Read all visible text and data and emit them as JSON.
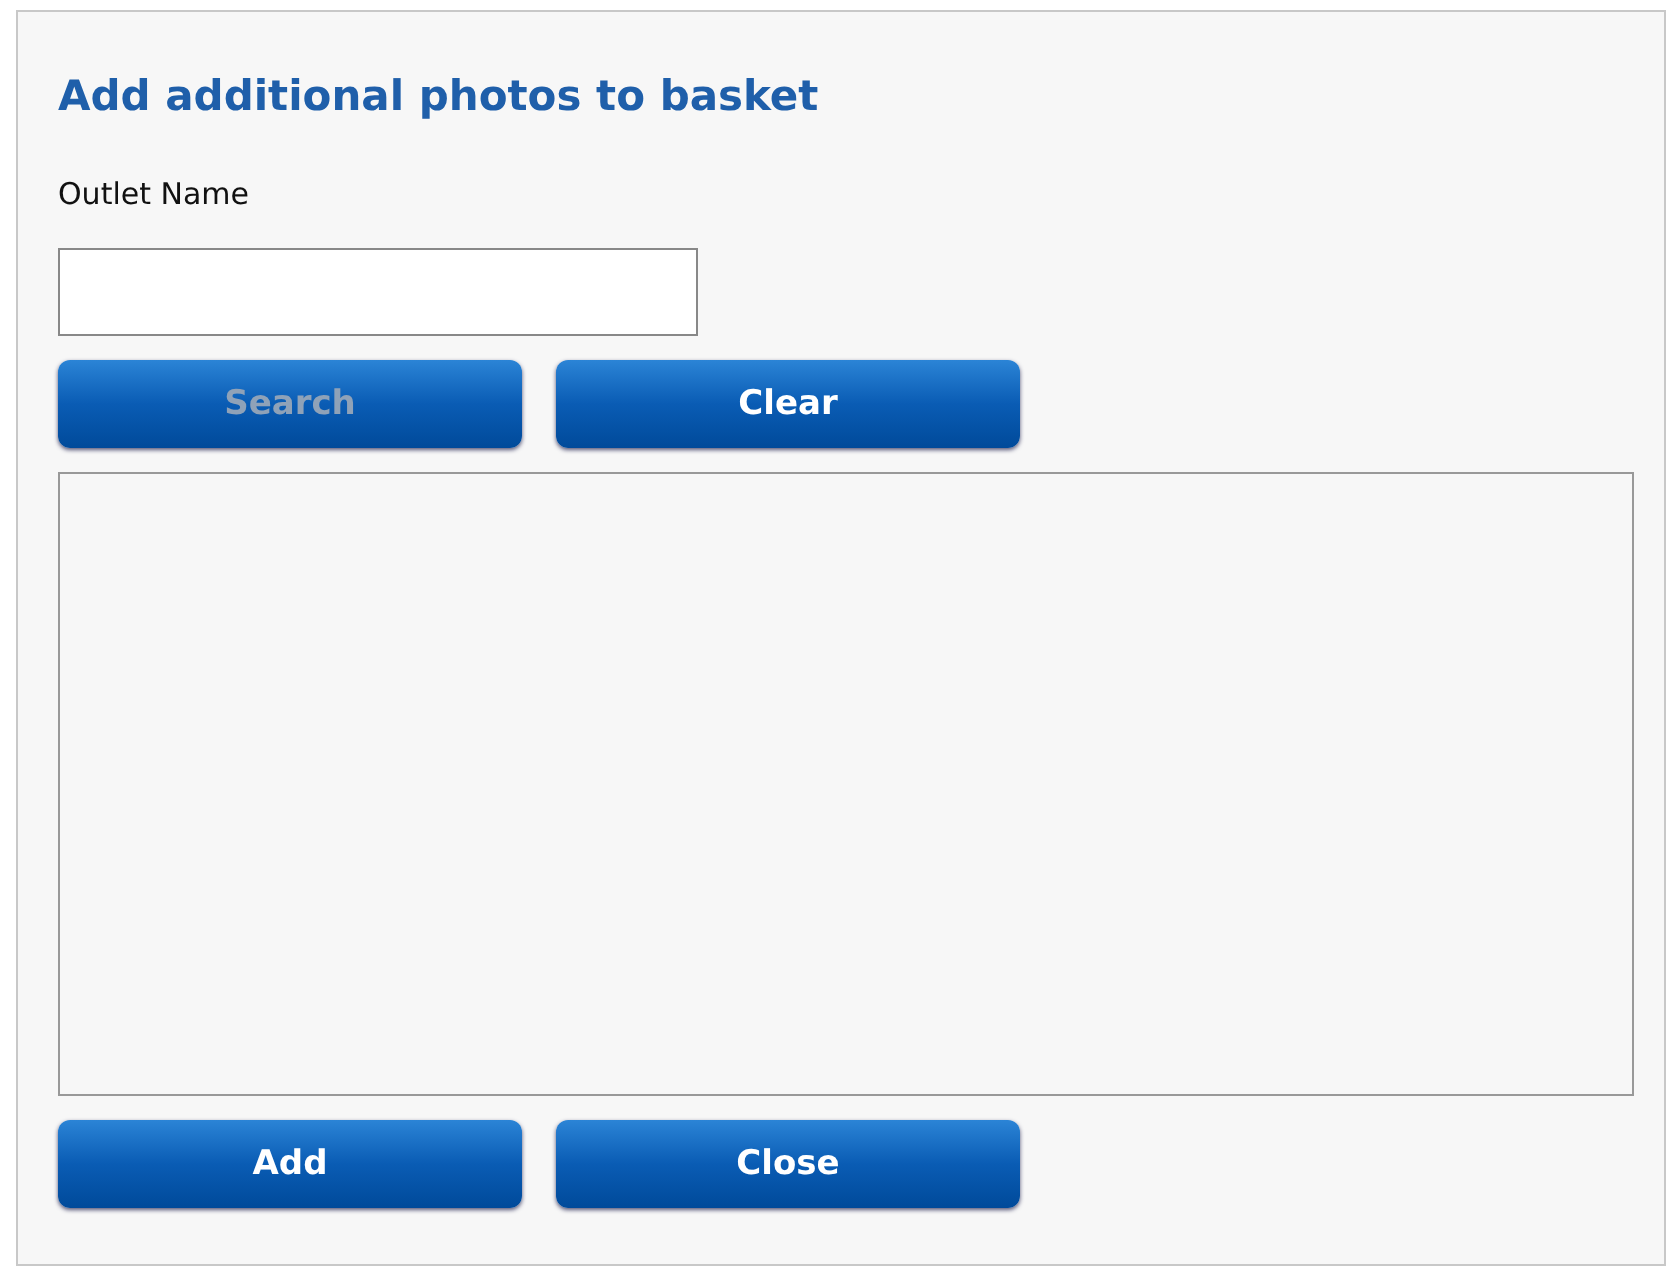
{
  "dialog": {
    "title": "Add additional photos to basket"
  },
  "field": {
    "label": "Outlet Name"
  },
  "search_buttons": [
    {
      "label": "Search",
      "disabled": true
    },
    {
      "label": "Clear",
      "disabled": false
    }
  ],
  "results": {
    "kind": "empty-list"
  },
  "footer_buttons": [
    {
      "label": "Add",
      "disabled": false
    },
    {
      "label": "Close",
      "disabled": false
    }
  ]
}
